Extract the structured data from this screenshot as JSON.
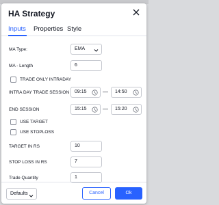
{
  "dialog": {
    "title": "HA Strategy"
  },
  "tabs": [
    {
      "label": "Inputs",
      "active": true
    },
    {
      "label": "Properties",
      "active": false
    },
    {
      "label": "Style",
      "active": false
    }
  ],
  "inputs": {
    "ma_type": {
      "label": "MA Type:",
      "value": "EMA"
    },
    "ma_length": {
      "label": "MA - Length",
      "value": "6"
    },
    "trade_only_intraday": {
      "label": "TRADE ONLY INTRADAY",
      "checked": false
    },
    "intraday_session": {
      "label": "INTRA DAY TRADE SESSION",
      "start": "09:15",
      "end": "14:50",
      "separator": "—"
    },
    "end_session": {
      "label": "END SESSION",
      "start": "15:15",
      "end": "15:20",
      "separator": "—"
    },
    "use_target": {
      "label": "USE TARGET",
      "checked": false
    },
    "use_stoploss": {
      "label": "USE STOPLOSS",
      "checked": false
    },
    "target_rs": {
      "label": "TARGET IN RS",
      "value": "10"
    },
    "stoploss_rs": {
      "label": "STOP LOSS IN RS",
      "value": "7"
    },
    "trade_quantity": {
      "label": "Trade Quantity",
      "value": "1"
    }
  },
  "footer": {
    "defaults_label": "Defaults",
    "cancel_label": "Cancel",
    "ok_label": "Ok"
  },
  "colors": {
    "accent": "#2962ff",
    "text": "#131722",
    "border": "#c5c8cf"
  }
}
